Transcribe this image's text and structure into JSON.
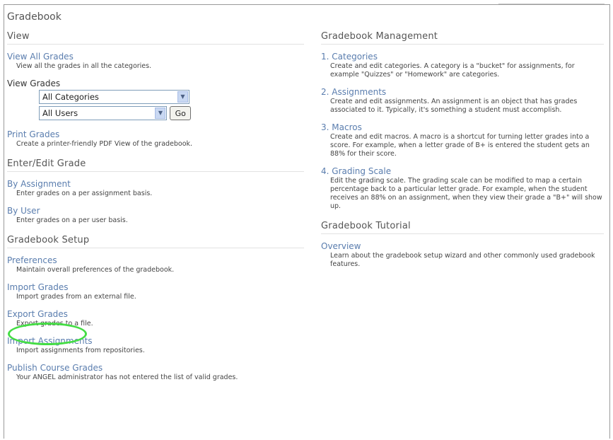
{
  "page_title": "Gradebook",
  "left": {
    "view": {
      "heading": "View",
      "view_all": {
        "label": "View All Grades",
        "desc": "View all the grades in all the categories."
      },
      "view_grades_label": "View Grades",
      "category_select": "All Categories",
      "user_select": "All Users",
      "go_label": "Go",
      "print": {
        "label": "Print Grades",
        "desc": "Create a printer-friendly PDF View of the gradebook."
      }
    },
    "enter_edit": {
      "heading": "Enter/Edit Grade",
      "by_assignment": {
        "label": "By Assignment",
        "desc": "Enter grades on a per assignment basis."
      },
      "by_user": {
        "label": "By User",
        "desc": "Enter grades on a per user basis."
      }
    },
    "setup": {
      "heading": "Gradebook Setup",
      "preferences": {
        "label": "Preferences",
        "desc": "Maintain overall preferences of the gradebook."
      },
      "import_grades": {
        "label": "Import Grades",
        "desc": "Import grades from an external file."
      },
      "export_grades": {
        "label": "Export Grades",
        "desc": "Export grades to a file."
      },
      "import_assignments": {
        "label": "Import Assignments",
        "desc": "Import assignments from repositories."
      },
      "publish": {
        "label": "Publish Course Grades",
        "desc": "Your ANGEL administrator has not entered the list of valid grades."
      }
    }
  },
  "right": {
    "management": {
      "heading": "Gradebook Management",
      "categories": {
        "label": "1. Categories",
        "desc": "Create and edit categories. A category is a \"bucket\" for assignments, for example \"Quizzes\" or \"Homework\" are categories."
      },
      "assignments": {
        "label": "2. Assignments",
        "desc": "Create and edit assignments. An assignment is an object that has grades associated to it. Typically, it's something a student must accomplish."
      },
      "macros": {
        "label": "3. Macros",
        "desc": "Create and edit macros. A macro is a shortcut for turning letter grades into a score. For example, when a letter grade of B+ is entered the student gets an 88% for their score."
      },
      "grading_scale": {
        "label": "4. Grading Scale",
        "desc": "Edit the grading scale. The grading scale can be modified to map a certain percentage back to a particular letter grade. For example, when the student receives an 88% on an assignment, when they view their grade a \"B+\" will show up."
      }
    },
    "tutorial": {
      "heading": "Gradebook Tutorial",
      "overview": {
        "label": "Overview",
        "desc": "Learn about the gradebook setup wizard and other commonly used gradebook features."
      }
    }
  },
  "colors": {
    "link": "#5a7dae",
    "highlight_ellipse": "#44dd44"
  }
}
